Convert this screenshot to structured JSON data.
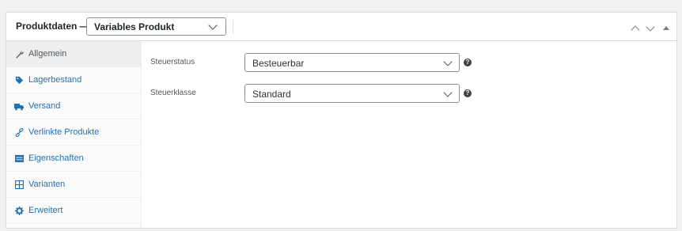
{
  "header": {
    "title": "Produktdaten —",
    "product_type": "Variables Produkt"
  },
  "sidebar": {
    "items": [
      {
        "label": "Allgemein",
        "icon": "wrench-icon",
        "active": true
      },
      {
        "label": "Lagerbestand",
        "icon": "tag-icon",
        "active": false
      },
      {
        "label": "Versand",
        "icon": "truck-icon",
        "active": false
      },
      {
        "label": "Verlinkte Produkte",
        "icon": "link-icon",
        "active": false
      },
      {
        "label": "Eigenschaften",
        "icon": "list-icon",
        "active": false
      },
      {
        "label": "Varianten",
        "icon": "grid-icon",
        "active": false
      },
      {
        "label": "Erweitert",
        "icon": "gear-icon",
        "active": false
      }
    ]
  },
  "fields": {
    "tax_status": {
      "label": "Steuerstatus",
      "value": "Besteuerbar"
    },
    "tax_class": {
      "label": "Steuerklasse",
      "value": "Standard"
    }
  },
  "help_glyph": "?",
  "colors": {
    "link": "#2271b1",
    "border": "#dcdcde",
    "active_tab_bg": "#eeeeee"
  }
}
